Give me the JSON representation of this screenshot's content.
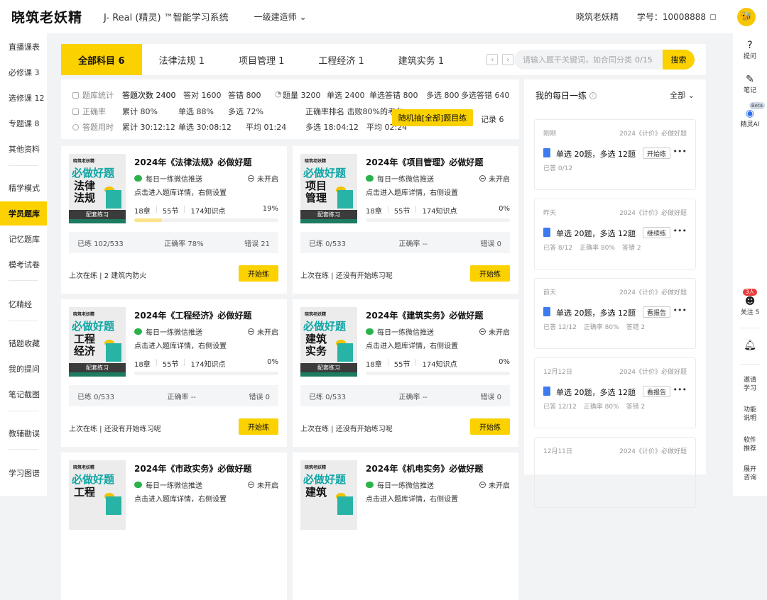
{
  "topbar": {
    "logo": "晓筑老妖精",
    "app_title": "J- Real (精灵) ™智能学习系统",
    "cert": "一级建造师",
    "user_name": "晓筑老妖精",
    "user_id": "学号：10008888"
  },
  "sidebar": {
    "items": [
      "直播课表",
      "必修课 3",
      "选修课 12",
      "专题课 8",
      "其他资料",
      "精学模式",
      "学员题库",
      "记忆题库",
      "模考试卷",
      "忆精经",
      "错题收藏",
      "我的提问",
      "笔记截图",
      "教辅勘误",
      "学习图谱"
    ],
    "active": "学员题库"
  },
  "rightrail": {
    "ask": "提问",
    "note": "笔记",
    "ai": "精灵AI",
    "beta": "Beta",
    "badge": "3人",
    "follow": "关注 5",
    "invite": "邀请\n学习",
    "feature": "功能\n说明",
    "software": "软件\n推荐",
    "expand": "展开\n咨询"
  },
  "tabs": [
    "全部科目 6",
    "法律法规 1",
    "项目管理 1",
    "工程经济 1",
    "建筑实务 1"
  ],
  "search": {
    "placeholder": "请输入题干关键词，如合同分类",
    "count": "0/15",
    "button": "搜索"
  },
  "stats": {
    "row1_label": "题库统计",
    "row1": [
      "答题次数 2400",
      "答对 1600",
      "答错 800"
    ],
    "row1b": [
      "题量 3200",
      "单选 2400",
      "单选答错 800",
      "多选 800",
      "多选答错 640"
    ],
    "row2_label": "正确率",
    "row2": [
      "累计 80%",
      "单选 88%",
      "多选 72%",
      "正确率排名 击败80%的考友"
    ],
    "row3_label": "答题用时",
    "row3": [
      "累计 30:12:12",
      "单选 30:08:12",
      "平均 01:24",
      "多选 18:04:12",
      "平均 02:24"
    ],
    "random_btn": "随机抽[全部]题目练",
    "record": "记录 6"
  },
  "cards": [
    {
      "title": "2024年《法律法规》必做好题",
      "cover_big": "必做好题",
      "cover_sub": "法律\n法规",
      "push": "每日一练微信推送",
      "status": "未开启",
      "hint": "点击进入题库详情，右侧设置",
      "chapters": "18章",
      "sections": "55节",
      "points": "174知识点",
      "pct": "19%",
      "progress": 0.19,
      "done": "已练  102/533",
      "accuracy": "正确率  78%",
      "wrong": "错误  21",
      "last": "上次在练 | 2 建筑内防火",
      "go": "开始练",
      "cover_tag": "配套练习",
      "brand": "晓筑老妖精"
    },
    {
      "title": "2024年《项目管理》必做好题",
      "cover_big": "必做好题",
      "cover_sub": "项目\n管理",
      "push": "每日一练微信推送",
      "status": "未开启",
      "hint": "点击进入题库详情，右侧设置",
      "chapters": "18章",
      "sections": "55节",
      "points": "174知识点",
      "pct": "0%",
      "progress": 0,
      "done": "已练  0/533",
      "accuracy": "正确率  --",
      "wrong": "错误  0",
      "last": "上次在练 | 还没有开始练习呢",
      "go": "开始练",
      "cover_tag": "配套练习",
      "brand": "晓筑老妖精"
    },
    {
      "title": "2024年《工程经济》必做好题",
      "cover_big": "必做好题",
      "cover_sub": "工程\n经济",
      "push": "每日一练微信推送",
      "status": "未开启",
      "hint": "点击进入题库详情，右侧设置",
      "chapters": "18章",
      "sections": "55节",
      "points": "174知识点",
      "pct": "0%",
      "progress": 0,
      "done": "已练  0/533",
      "accuracy": "正确率  --",
      "wrong": "错误  0",
      "last": "上次在练 | 还没有开始练习呢",
      "go": "开始练",
      "cover_tag": "配套练习",
      "brand": "晓筑老妖精"
    },
    {
      "title": "2024年《建筑实务》必做好题",
      "cover_big": "必做好题",
      "cover_sub": "建筑\n实务",
      "push": "每日一练微信推送",
      "status": "未开启",
      "hint": "点击进入题库详情，右侧设置",
      "chapters": "18章",
      "sections": "55节",
      "points": "174知识点",
      "pct": "0%",
      "progress": 0,
      "done": "已练  0/533",
      "accuracy": "正确率  --",
      "wrong": "错误  0",
      "last": "上次在练 | 还没有开始练习呢",
      "go": "开始练",
      "cover_tag": "配套练习",
      "brand": "晓筑老妖精"
    },
    {
      "title": "2024年《市政实务》必做好题",
      "cover_big": "必做好题",
      "cover_sub": "工程",
      "push": "每日一练微信推送",
      "status": "未开启",
      "hint": "点击进入题库详情，右侧设置",
      "brand": "晓筑老妖精"
    },
    {
      "title": "2024年《机电实务》必做好题",
      "cover_big": "必做好题",
      "cover_sub": "建筑",
      "push": "每日一练微信推送",
      "status": "未开启",
      "hint": "点击进入题库详情，右侧设置",
      "brand": "晓筑老妖精"
    }
  ],
  "daily": {
    "title": "我的每日一练",
    "filter": "全部",
    "items": [
      {
        "date": "刚刚",
        "src": "2024《计价》必做好题",
        "text": "单选 20题，多选 12题",
        "btn": "开始练",
        "answered": "已答 0/12",
        "acc": "",
        "wrong": ""
      },
      {
        "date": "昨天",
        "src": "2024《计价》必做好题",
        "text": "单选 20题，多选 12题",
        "btn": "继续练",
        "answered": "已答 8/12",
        "acc": "正确率 80%",
        "wrong": "答错 2"
      },
      {
        "date": "前天",
        "src": "2024《计价》必做好题",
        "text": "单选 20题，多选 12题",
        "btn": "看报告",
        "answered": "已答 12/12",
        "acc": "正确率 80%",
        "wrong": "答错 2"
      },
      {
        "date": "12月12日",
        "src": "2024《计价》必做好题",
        "text": "单选 20题，多选 12题",
        "btn": "看报告",
        "answered": "已答 12/12",
        "acc": "正确率 80%",
        "wrong": "答错 2"
      },
      {
        "date": "12月11日",
        "src": "2024《计价》必做好题"
      }
    ]
  },
  "colors": {
    "accent": "#fbd100",
    "teal": "#10a5a5",
    "progress": "#fbe28b"
  }
}
